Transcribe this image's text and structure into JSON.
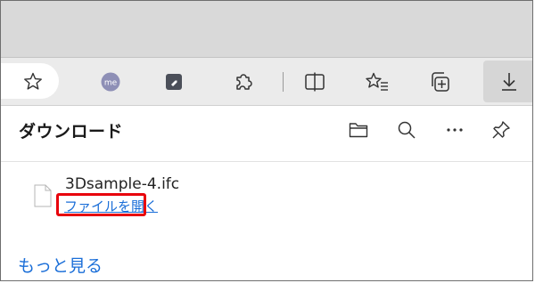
{
  "toolbar": {
    "icons": [
      "star-outline-icon",
      "me-profile-icon",
      "tag-extension-icon",
      "puzzle-extensions-icon",
      "split-screen-icon",
      "favorites-icon",
      "collections-icon",
      "download-icon"
    ],
    "me_badge": "me"
  },
  "downloads": {
    "title": "ダウンロード",
    "header_icons": [
      "folder-icon",
      "search-icon",
      "more-icon",
      "pin-icon"
    ],
    "items": [
      {
        "file_name": "3Dsample-4.ifc",
        "action_label": "ファイルを開く"
      }
    ],
    "see_more": "もっと見る"
  },
  "colors": {
    "link": "#1a6ed8",
    "highlight": "#e8000b",
    "me_badge": "#8e8fb6",
    "tag_icon": "#4b4f59"
  }
}
